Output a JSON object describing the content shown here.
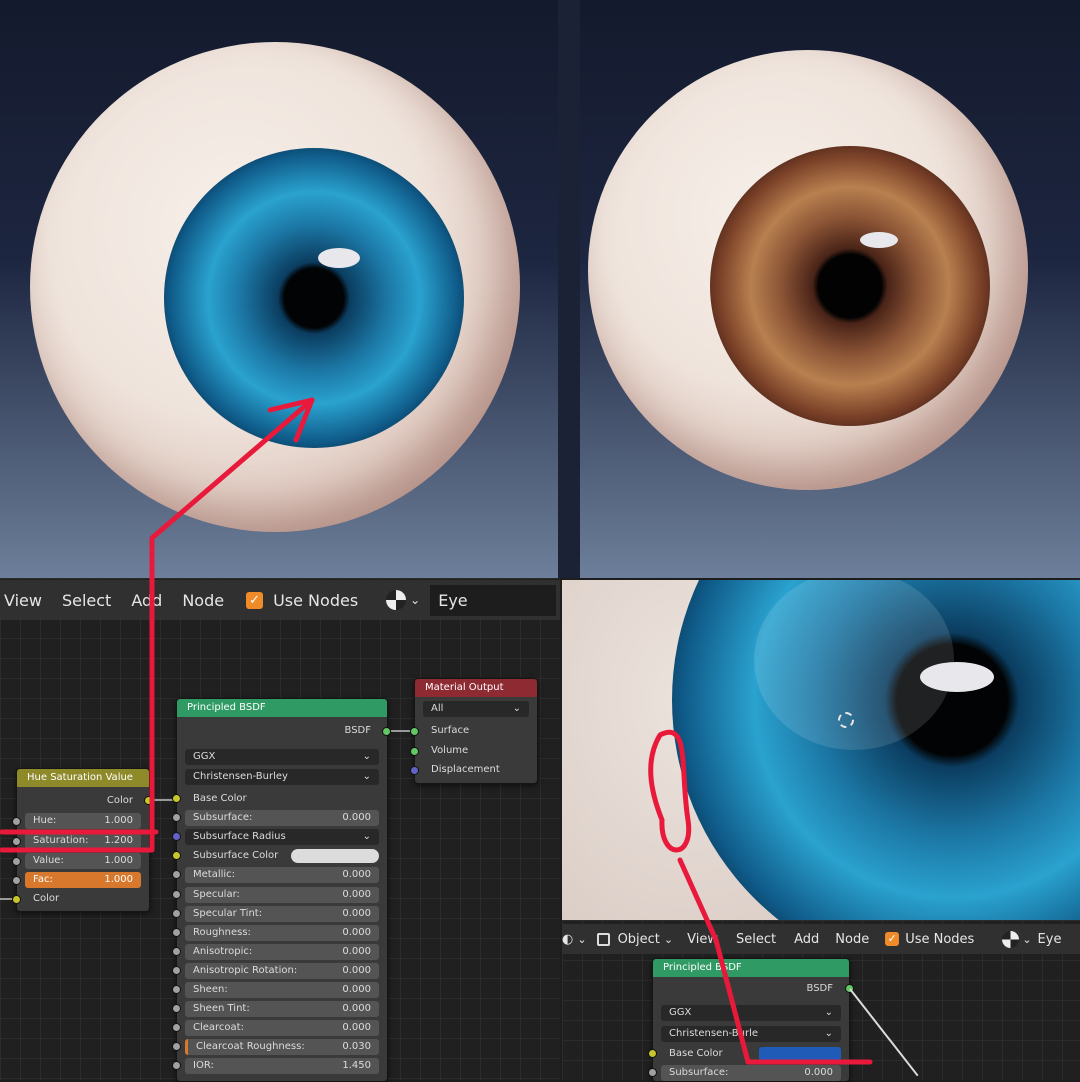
{
  "colors": {
    "accent": "#f08b2a",
    "annotation": "#e8193a",
    "node_green": "#2f9a63",
    "node_yellow": "#8e8a2a",
    "node_red": "#8e2a32",
    "blue_swatch": "#1f5bb7"
  },
  "top_renders": [
    {
      "name": "blue-eye-render",
      "iris_color": "blue"
    },
    {
      "name": "brown-eye-render",
      "iris_color": "brown"
    }
  ],
  "left_header": {
    "menu": [
      "View",
      "Select",
      "Add",
      "Node"
    ],
    "use_nodes_label": "Use Nodes",
    "use_nodes_checked": true,
    "material_name": "Eye"
  },
  "right_header": {
    "object_mode": "Object",
    "menu": [
      "View",
      "Select",
      "Add",
      "Node"
    ],
    "use_nodes_label": "Use Nodes",
    "material_name": "Eye"
  },
  "hsv_node": {
    "title": "Hue Saturation Value",
    "output_label": "Color",
    "fields": [
      {
        "label": "Hue:",
        "value": "1.000"
      },
      {
        "label": "Saturation:",
        "value": "1.200"
      },
      {
        "label": "Value:",
        "value": "1.000"
      },
      {
        "label": "Fac:",
        "value": "1.000"
      }
    ],
    "input_label": "Color"
  },
  "bsdf_node": {
    "title": "Principled BSDF",
    "output_label": "BSDF",
    "distribution": "GGX",
    "subsurface_method": "Christensen-Burley",
    "rows": [
      {
        "label": "Base Color",
        "value": "",
        "kind": "plain"
      },
      {
        "label": "Subsurface:",
        "value": "0.000",
        "kind": "field"
      },
      {
        "label": "Subsurface Radius",
        "value": "",
        "kind": "dropdown"
      },
      {
        "label": "Subsurface Color",
        "value": "",
        "kind": "color"
      },
      {
        "label": "Metallic:",
        "value": "0.000",
        "kind": "field"
      },
      {
        "label": "Specular:",
        "value": "0.000",
        "kind": "field"
      },
      {
        "label": "Specular Tint:",
        "value": "0.000",
        "kind": "field"
      },
      {
        "label": "Roughness:",
        "value": "0.000",
        "kind": "field"
      },
      {
        "label": "Anisotropic:",
        "value": "0.000",
        "kind": "field"
      },
      {
        "label": "Anisotropic Rotation:",
        "value": "0.000",
        "kind": "field"
      },
      {
        "label": "Sheen:",
        "value": "0.000",
        "kind": "field"
      },
      {
        "label": "Sheen Tint:",
        "value": "0.000",
        "kind": "field"
      },
      {
        "label": "Clearcoat:",
        "value": "0.000",
        "kind": "field"
      },
      {
        "label": "Clearcoat Roughness:",
        "value": "0.030",
        "kind": "field"
      },
      {
        "label": "IOR:",
        "value": "1.450",
        "kind": "field"
      }
    ]
  },
  "output_node": {
    "title": "Material Output",
    "target": "All",
    "inputs": [
      "Surface",
      "Volume",
      "Displacement"
    ]
  },
  "bsdf_node_small": {
    "title": "Principled BSDF",
    "output_label": "BSDF",
    "distribution": "GGX",
    "subsurface_method": "Christensen-Burle",
    "base_color_label": "Base Color",
    "subsurface_label": "Subsurface:",
    "subsurface_value": "0.000"
  }
}
